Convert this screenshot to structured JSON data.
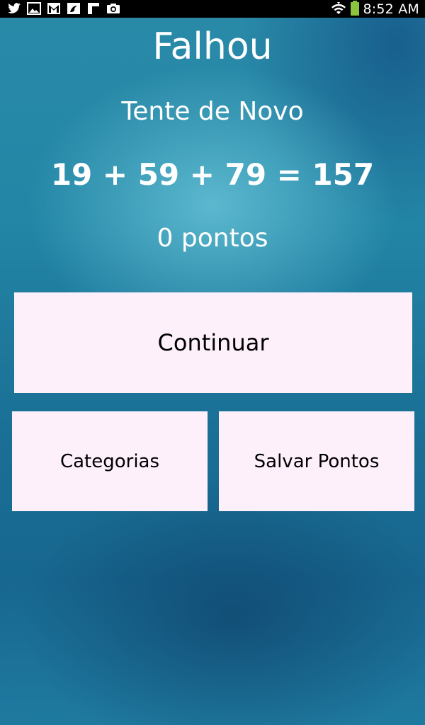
{
  "status_bar": {
    "time": "8:52 AM",
    "notification_icons": [
      "twitter-icon",
      "gallery-icon",
      "gmail-icon",
      "app-icon",
      "flipboard-icon",
      "camera-icon"
    ],
    "battery_color": "#8bc53f"
  },
  "result": {
    "title": "Falhou",
    "subtitle": "Tente de Novo",
    "equation": "19 + 59 + 79 = 157",
    "score": "0 pontos"
  },
  "actions": {
    "continue_label": "Continuar",
    "categories_label": "Categorias",
    "save_points_label": "Salvar Pontos"
  },
  "colors": {
    "button_background": "#fdf0fb",
    "text_on_background": "#ffffff"
  }
}
